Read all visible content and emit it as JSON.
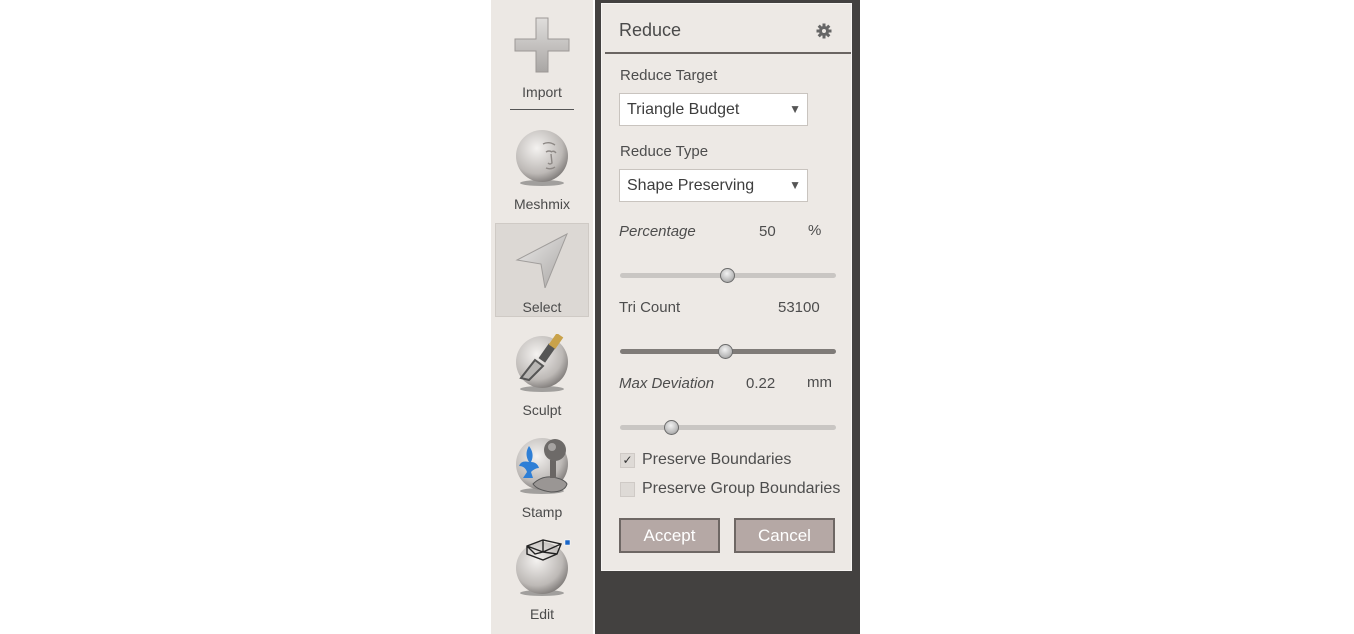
{
  "toolbar": {
    "tools": [
      {
        "label": "Import",
        "icon": "plus-icon"
      },
      {
        "label": "Meshmix",
        "icon": "face-sphere-icon"
      },
      {
        "label": "Select",
        "icon": "arrow-pointer-icon",
        "selected": true
      },
      {
        "label": "Sculpt",
        "icon": "brush-sphere-icon"
      },
      {
        "label": "Stamp",
        "icon": "stamp-fleur-de-lis-icon"
      },
      {
        "label": "Edit",
        "icon": "mesh-edit-sphere-icon"
      }
    ]
  },
  "panel": {
    "title": "Reduce",
    "settings_icon": "gear-icon",
    "reduce_target": {
      "label": "Reduce Target",
      "value": "Triangle Budget"
    },
    "reduce_type": {
      "label": "Reduce Type",
      "value": "Shape Preserving"
    },
    "percentage": {
      "label": "Percentage",
      "value": "50",
      "unit": "%",
      "slider_fraction": 0.5
    },
    "tri_count": {
      "label": "Tri Count",
      "value": "53100",
      "slider_fraction": 0.49
    },
    "max_deviation": {
      "label": "Max Deviation",
      "value": "0.22",
      "unit": "mm",
      "slider_fraction": 0.24
    },
    "preserve_boundaries": {
      "label": "Preserve Boundaries",
      "checked": true,
      "mark": "✓"
    },
    "preserve_group_boundaries": {
      "label": "Preserve Group Boundaries",
      "checked": false
    },
    "accept_label": "Accept",
    "cancel_label": "Cancel"
  },
  "colors": {
    "panel_bg": "#ede9e5",
    "viewport_bg": "#434140",
    "button_bg": "#b5a8a5",
    "stamp_accent": "#2e7fd6"
  }
}
